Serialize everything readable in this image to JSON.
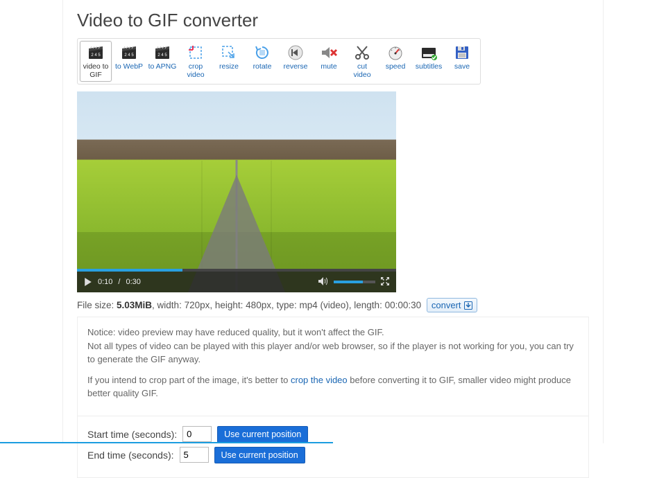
{
  "title": "Video to GIF converter",
  "toolbar": {
    "items": [
      {
        "id": "video-to-gif",
        "label": "video to GIF",
        "active": true,
        "icon": "clapper-245"
      },
      {
        "id": "to-webp",
        "label": "to WebP",
        "icon": "clapper-245"
      },
      {
        "id": "to-apng",
        "label": "to APNG",
        "icon": "clapper-245"
      },
      {
        "id": "crop-video",
        "label": "crop video",
        "icon": "crop"
      },
      {
        "id": "resize",
        "label": "resize",
        "icon": "resize"
      },
      {
        "id": "rotate",
        "label": "rotate",
        "icon": "rotate"
      },
      {
        "id": "reverse",
        "label": "reverse",
        "icon": "reverse"
      },
      {
        "id": "mute",
        "label": "mute",
        "icon": "mute"
      },
      {
        "id": "cut-video",
        "label": "cut video",
        "icon": "cut"
      },
      {
        "id": "speed",
        "label": "speed",
        "icon": "speed"
      },
      {
        "id": "subtitles",
        "label": "subtitles",
        "icon": "subtitles"
      },
      {
        "id": "save",
        "label": "save",
        "icon": "save"
      }
    ]
  },
  "player": {
    "current_time": "0:10",
    "total_time": "0:30",
    "separator": "/"
  },
  "meta": {
    "filesize_label": "File size: ",
    "filesize_value": "5.03MiB",
    "width_label": ", width: ",
    "width_value": "720px",
    "height_label": ", height: ",
    "height_value": "480px",
    "type_label": ", type: ",
    "type_value": "mp4 (video)",
    "length_label": ", length: ",
    "length_value": "00:00:30",
    "convert_label": "convert"
  },
  "notice": {
    "p1": "Notice: video preview may have reduced quality, but it won't affect the GIF.",
    "p2a": "Not all types of video can be played with this player and/or web browser, so if the player is not working for you, you can try to generate the GIF anyway.",
    "p3a": "If you intend to crop part of the image, it's better to ",
    "p3link": "crop the video",
    "p3b": " before converting it to GIF, smaller video might produce better quality GIF."
  },
  "time": {
    "start_label": "Start time (seconds):",
    "start_value": "0",
    "end_label": "End time (seconds):",
    "end_value": "5",
    "use_current": "Use current position"
  }
}
